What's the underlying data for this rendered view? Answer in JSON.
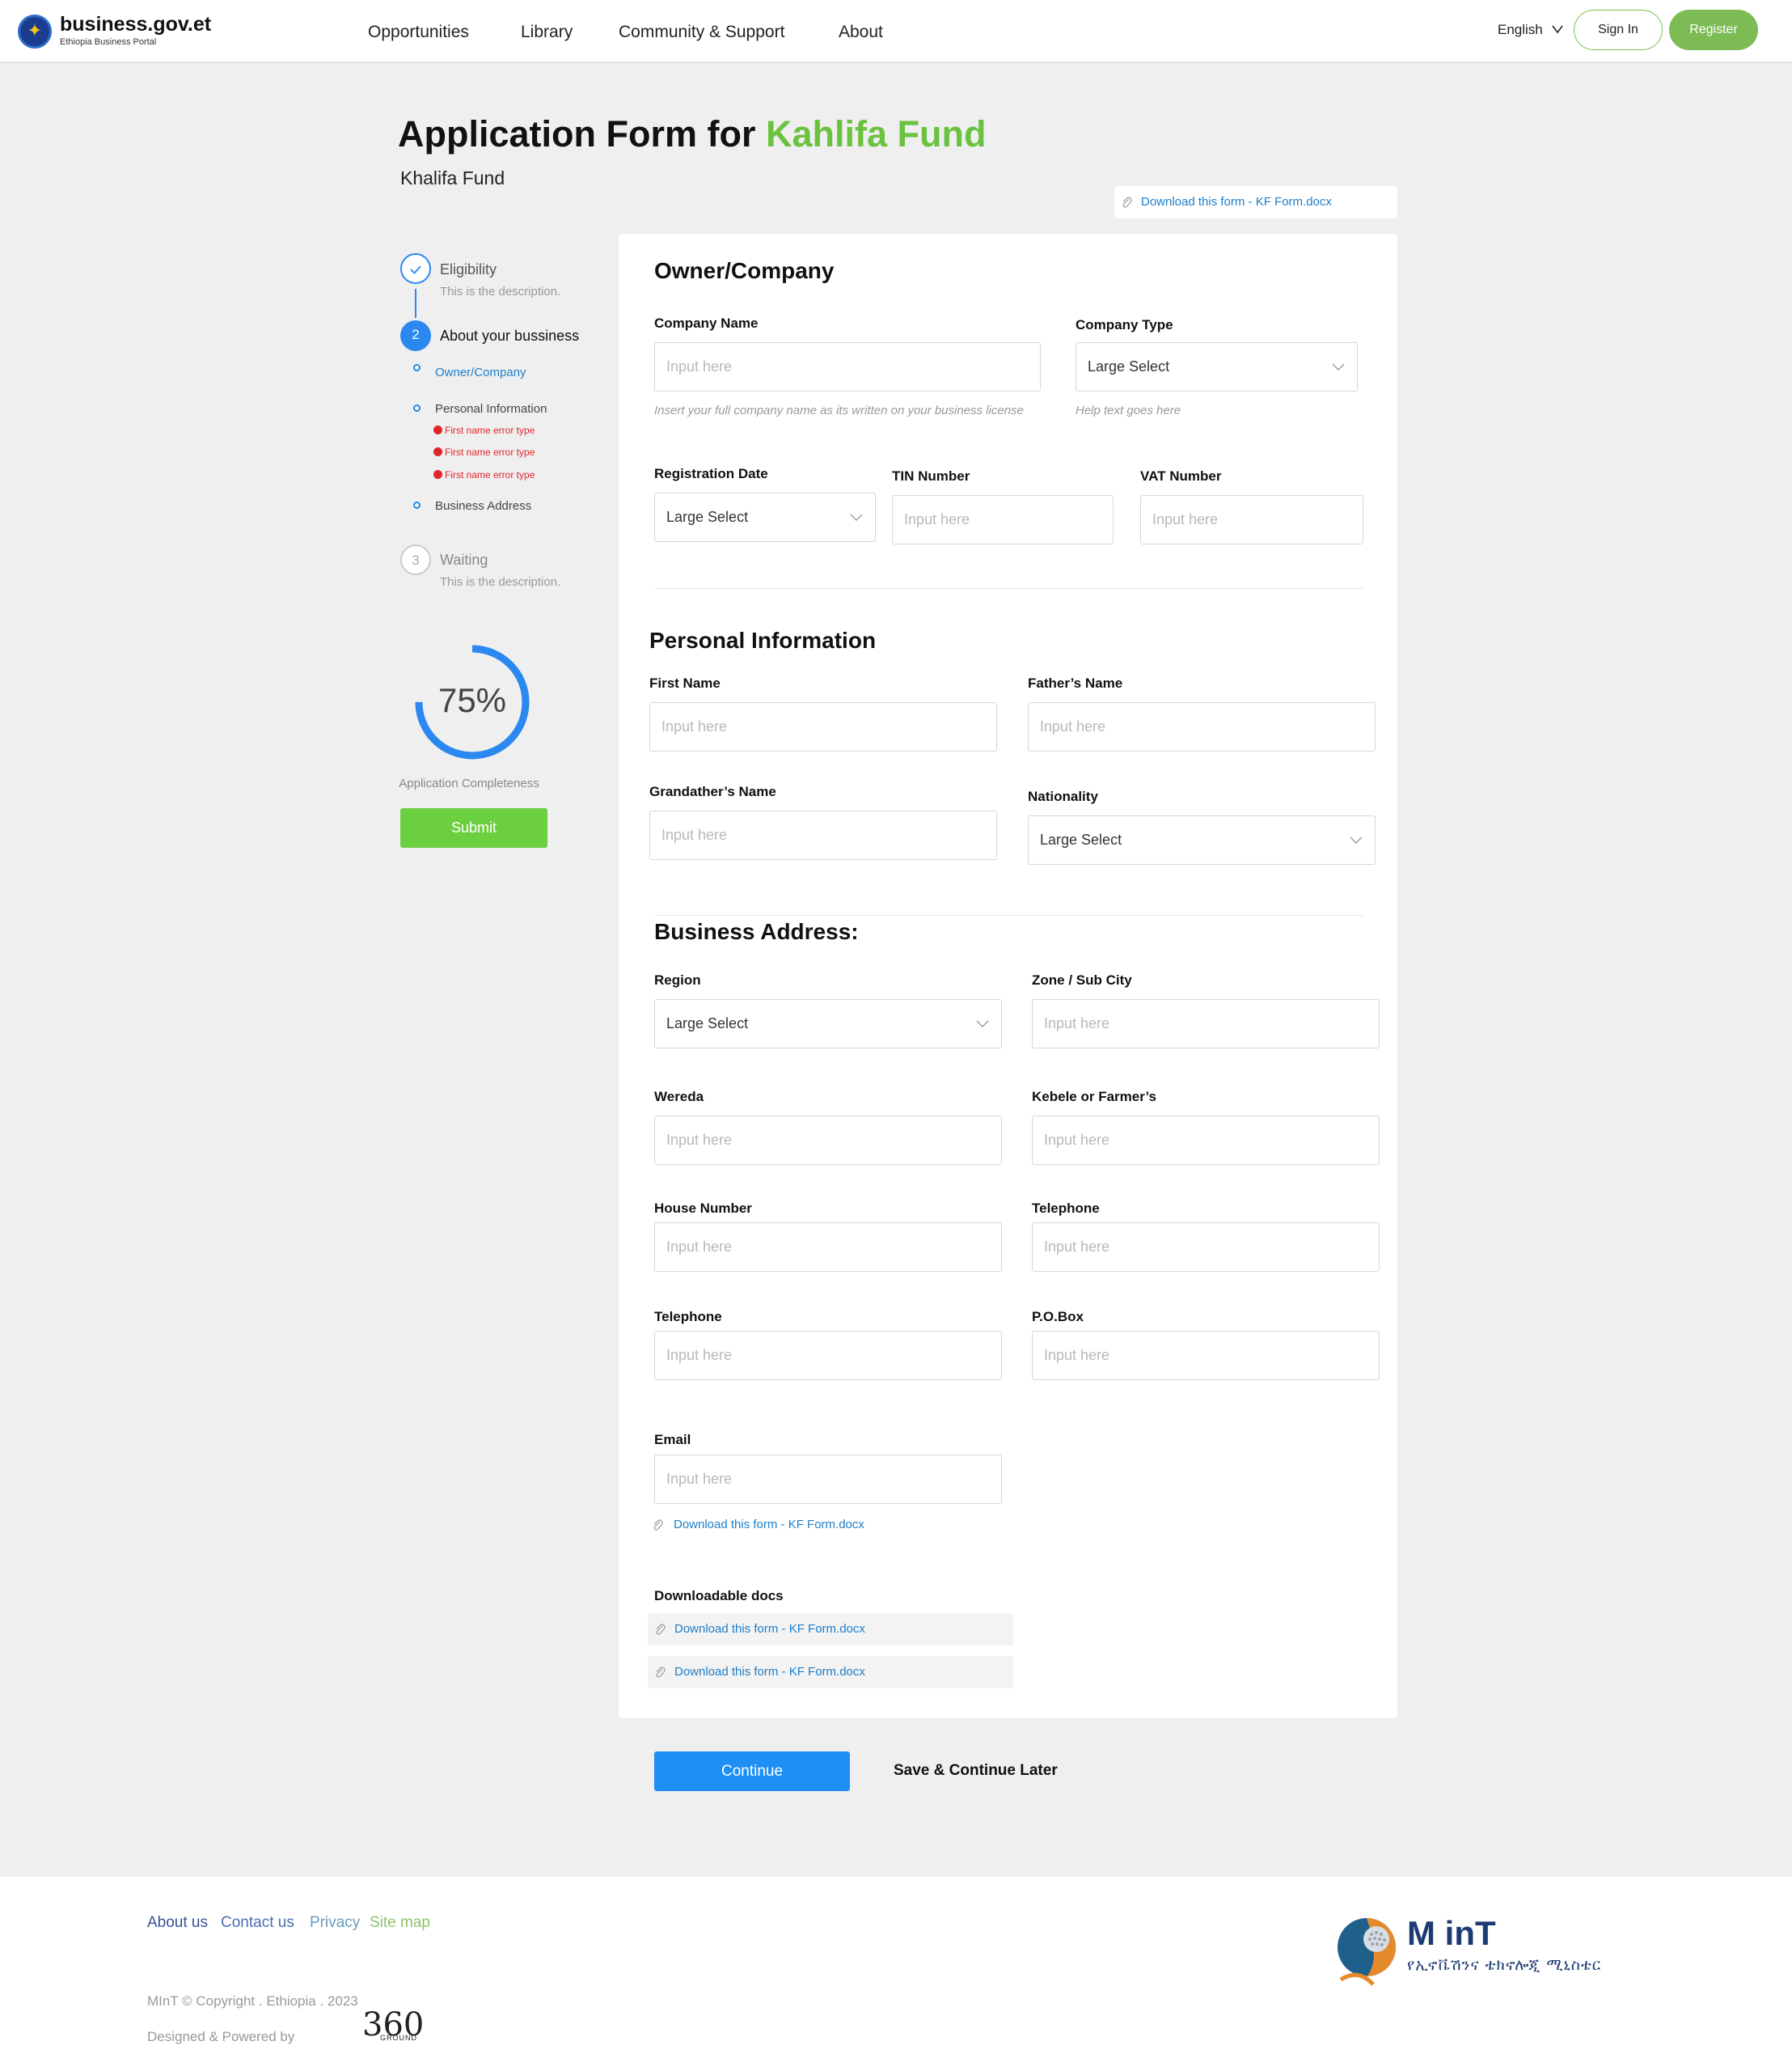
{
  "header": {
    "brand_title": "business.gov.et",
    "brand_subtitle": "Ethiopia Business Portal",
    "nav": [
      "Opportunities",
      "Library",
      "Community & Support",
      "About"
    ],
    "language": "English",
    "sign_in": "Sign In",
    "register": "Register"
  },
  "page": {
    "title_prefix": "Application Form for ",
    "title_accent": "Kahlifa Fund",
    "subtitle": "Khalifa Fund",
    "download_top": "Download this form - KF Form.docx"
  },
  "stepper": {
    "steps": [
      {
        "number": "",
        "title": "Eligibility",
        "description": "This is the description.",
        "state": "done"
      },
      {
        "number": "2",
        "title": "About your bussiness",
        "state": "active"
      },
      {
        "number": "3",
        "title": "Waiting",
        "description": "This is the description.",
        "state": "pending"
      }
    ],
    "substeps": [
      {
        "label": "Owner/Company",
        "active": true
      },
      {
        "label": "Personal Information",
        "errors": [
          "First name error type",
          "First name error type",
          "First name error type"
        ]
      },
      {
        "label": "Business Address"
      }
    ]
  },
  "progress": {
    "value": 0.75,
    "label": "75%",
    "caption": "Application Completeness",
    "submit": "Submit"
  },
  "form": {
    "owner_company": {
      "title": "Owner/Company",
      "company_name": {
        "label": "Company Name",
        "placeholder": "Input here",
        "help": "Insert your full company name as its written on your business license"
      },
      "company_type": {
        "label": "Company Type",
        "value": "Large Select",
        "help": "Help text goes here"
      },
      "registration_date": {
        "label": "Registration Date",
        "value": "Large Select"
      },
      "tin_number": {
        "label": "TIN Number",
        "placeholder": "Input here"
      },
      "vat_number": {
        "label": "VAT Number",
        "placeholder": "Input here"
      }
    },
    "personal_information": {
      "title": "Personal Information",
      "first_name": {
        "label": "First Name",
        "placeholder": "Input here"
      },
      "fathers_name": {
        "label": "Father’s Name",
        "placeholder": "Input here"
      },
      "grandfathers_name": {
        "label": "Grandather’s Name",
        "placeholder": "Input here"
      },
      "nationality": {
        "label": "Nationality",
        "value": "Large Select"
      }
    },
    "business_address": {
      "title": "Business Address:",
      "region": {
        "label": "Region",
        "value": "Large Select"
      },
      "zone": {
        "label": "Zone / Sub City",
        "placeholder": "Input here"
      },
      "wereda": {
        "label": "Wereda",
        "placeholder": "Input here"
      },
      "kebele": {
        "label": "Kebele or Farmer’s",
        "placeholder": "Input here"
      },
      "house_number": {
        "label": "House Number",
        "placeholder": "Input here"
      },
      "telephone_1": {
        "label": "Telephone",
        "placeholder": "Input here"
      },
      "telephone_2": {
        "label": "Telephone",
        "placeholder": "Input here"
      },
      "po_box": {
        "label": "P.O.Box",
        "placeholder": "Input here"
      },
      "email": {
        "label": "Email",
        "placeholder": "Input here"
      },
      "download_link": "Download this form - KF Form.docx"
    },
    "downloadable_docs": {
      "title": "Downloadable docs",
      "items": [
        "Download this form - KF Form.docx",
        "Download this form - KF Form.docx"
      ]
    }
  },
  "actions": {
    "continue": "Continue",
    "save_later": "Save & Continue Later"
  },
  "footer": {
    "links": [
      "About us",
      "Contact us",
      "Privacy",
      "Site map"
    ],
    "copyright": "MInT © Copyright . Ethiopia . 2023",
    "powered_by": "Designed & Powered by",
    "powered_logo": "360",
    "powered_logo_sub": "GROUND",
    "mint_title": "M inT",
    "mint_amharic": "የኢኖቬሽንና ቴክኖሎጂ ሚኒስቴር"
  },
  "colors": {
    "accent_green": "#6ac23f",
    "primary_blue": "#1e8ff5",
    "link_blue": "#1e7ec8",
    "error_red": "#e3262e"
  }
}
